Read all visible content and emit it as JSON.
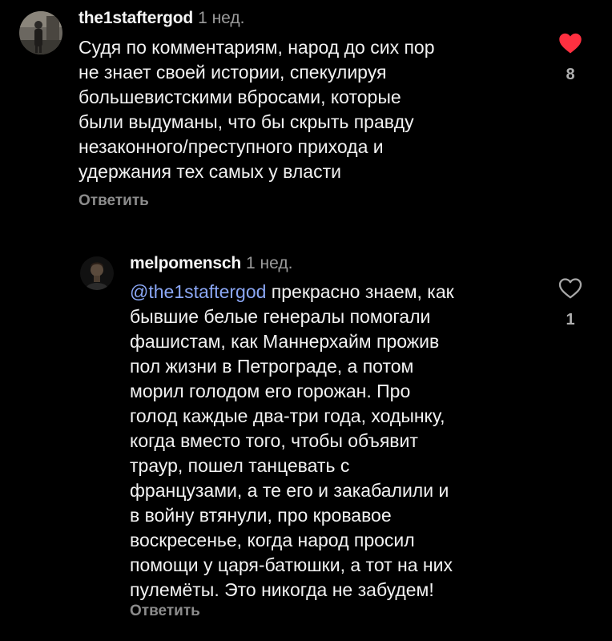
{
  "colors": {
    "background": "#000000",
    "text": "#f2f2f2",
    "muted": "#9a9a9a",
    "mention": "#8ba7f5",
    "like_active": "#ff3040"
  },
  "comments": [
    {
      "username": "the1staftergod",
      "time": "1 нед.",
      "lines": [
        "Судя по комментариям, народ до сих пор",
        "не знает своей истории, спекулируя",
        "большевистскими вбросами, которые",
        "были выдуманы, что бы скрыть правду",
        "незаконного/преступного прихода  и",
        "удержания тех самых у власти"
      ],
      "reply_label": "Ответить",
      "like_icon": "heart-filled-icon",
      "liked": true,
      "likes": "8"
    },
    {
      "username": "melpomensch",
      "time": "1 нед.",
      "mention": "@the1staftergod",
      "first_line_rest": " прекрасно знаем, как",
      "lines": [
        "бывшие белые генералы помогали",
        "фашистам, как Маннерхайм прожив",
        "пол жизни в Петрограде, а потом",
        "морил голодом его горожан. Про",
        "голод каждые два-три года, ходынку,",
        "когда вместо того, чтобы объявит",
        "траур, пошел танцевать с",
        "французами, а те его и закабалили и",
        "в войну втянули, про кровавое",
        "воскресенье, когда народ просил",
        "помощи у царя-батюшки, а тот на них",
        "пулемёты. Это никогда не забудем!"
      ],
      "reply_label": "Ответить",
      "like_icon": "heart-outline-icon",
      "liked": false,
      "likes": "1"
    }
  ]
}
